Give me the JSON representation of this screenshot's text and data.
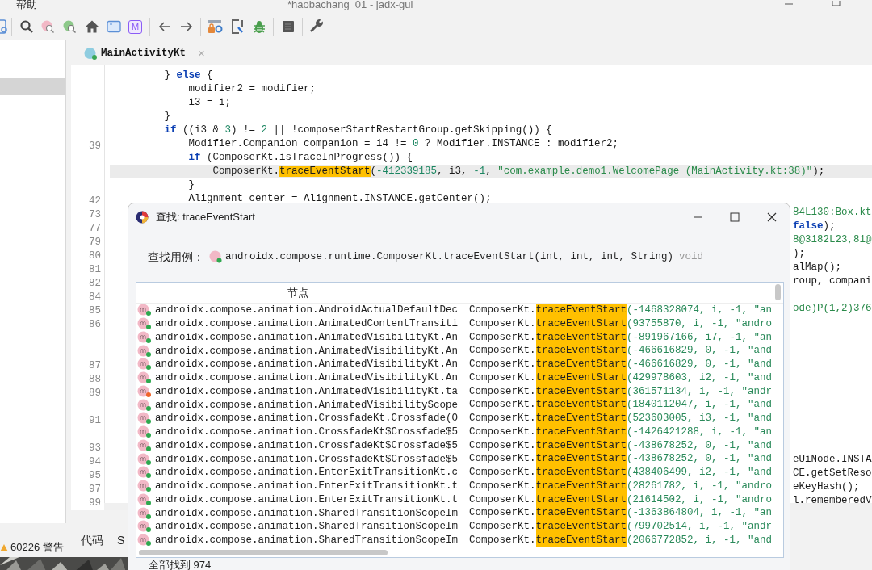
{
  "menu": {
    "item": "帮助"
  },
  "window": {
    "title": "*haobachang_01 - jadx-gui"
  },
  "toolbar": [
    {
      "kind": "doc"
    },
    {
      "kind": "separator"
    },
    {
      "kind": "search"
    },
    {
      "kind": "search-pink"
    },
    {
      "kind": "search-green"
    },
    {
      "kind": "home"
    },
    {
      "kind": "window"
    },
    {
      "kind": "letter",
      "label": "M"
    },
    {
      "kind": "separator"
    },
    {
      "kind": "back"
    },
    {
      "kind": "forward"
    },
    {
      "kind": "separator"
    },
    {
      "kind": "lock-gear"
    },
    {
      "kind": "export"
    },
    {
      "kind": "bug"
    },
    {
      "kind": "separator"
    },
    {
      "kind": "panel"
    },
    {
      "kind": "separator"
    },
    {
      "kind": "wrench"
    }
  ],
  "tree": {
    "rows": [
      {
        "selected": true
      }
    ]
  },
  "status": {
    "warnings": "60226 警告"
  },
  "editor_tabs": [
    {
      "label": "MainActivityKt",
      "close": "×",
      "selected": true
    }
  ],
  "code_lines": [
    {
      "current": false,
      "segments": [
        {
          "kind": "plain",
          "text": "         } "
        },
        {
          "kind": "kw",
          "text": "else"
        },
        {
          "kind": "plain",
          "text": " {"
        }
      ]
    },
    {
      "current": false,
      "segments": [
        {
          "kind": "plain",
          "text": "             modifier2 = modifier;"
        }
      ]
    },
    {
      "current": false,
      "segments": [
        {
          "kind": "plain",
          "text": "             i3 = i;"
        }
      ]
    },
    {
      "current": false,
      "segments": [
        {
          "kind": "plain",
          "text": "         }"
        }
      ]
    },
    {
      "current": false,
      "segments": [
        {
          "kind": "kw",
          "text": "         if"
        },
        {
          "kind": "plain",
          "text": " ((i3 & "
        },
        {
          "kind": "num",
          "text": "3"
        },
        {
          "kind": "plain",
          "text": ") != "
        },
        {
          "kind": "num",
          "text": "2"
        },
        {
          "kind": "plain",
          "text": " || !composerStartRestartGroup.getSkipping()) {"
        }
      ]
    },
    {
      "num": "39",
      "current": false,
      "segments": [
        {
          "kind": "plain",
          "text": "             Modifier.Companion companion = i4 != "
        },
        {
          "kind": "num",
          "text": "0"
        },
        {
          "kind": "plain",
          "text": " ? Modifier.INSTANCE : modifier2;"
        }
      ]
    },
    {
      "current": false,
      "segments": [
        {
          "kind": "kw",
          "text": "             if"
        },
        {
          "kind": "plain",
          "text": " (ComposerKt.isTraceInProgress()) {"
        }
      ]
    },
    {
      "current": true,
      "segments": [
        {
          "kind": "plain",
          "text": "                 ComposerKt."
        },
        {
          "kind": "match",
          "text": "traceEventStart"
        },
        {
          "kind": "plain",
          "text": "("
        },
        {
          "kind": "num",
          "text": "-412339185"
        },
        {
          "kind": "plain",
          "text": ", i3, "
        },
        {
          "kind": "num",
          "text": "-1"
        },
        {
          "kind": "plain",
          "text": ", "
        },
        {
          "kind": "str",
          "text": "\"com.example.demo1.WelcomePage (MainActivity.kt:38)\""
        },
        {
          "kind": "plain",
          "text": ");"
        }
      ]
    },
    {
      "current": false,
      "segments": [
        {
          "kind": "plain",
          "text": "             }"
        }
      ]
    },
    {
      "num": "42",
      "current": false,
      "segments": [
        {
          "kind": "plain",
          "text": "             Alignment center = Alignment.INSTANCE.getCenter();"
        }
      ]
    }
  ],
  "covered_lines": [
    {
      "kind": "clipped",
      "num": "73",
      "segments": [
        {
          "kind": "str",
          "text": "84L130:Box.kt"
        }
      ]
    },
    {
      "kind": "clipped",
      "num": "77",
      "segments": [
        {
          "kind": "kw",
          "text": "false"
        },
        {
          "kind": "plain",
          "text": ");"
        }
      ]
    },
    {
      "kind": "clipped",
      "num": "79",
      "segments": [
        {
          "kind": "str",
          "text": "8@3182L23,81@"
        }
      ]
    },
    {
      "kind": "clipped",
      "num": "80",
      "segments": [
        {
          "kind": "plain",
          "text": ");"
        }
      ]
    },
    {
      "kind": "clipped",
      "num": "81",
      "segments": [
        {
          "kind": "plain",
          "text": "alMap();"
        }
      ]
    },
    {
      "kind": "clipped",
      "num": "82",
      "segments": [
        {
          "kind": "plain",
          "text": "roup, compani"
        }
      ]
    },
    {
      "kind": "blank",
      "num": "84"
    },
    {
      "kind": "clipped",
      "num": "85",
      "segments": [
        {
          "kind": "str",
          "text": "ode)P(1,2)376"
        }
      ]
    },
    {
      "kind": "blank",
      "num": "86"
    },
    {
      "kind": "blank"
    },
    {
      "kind": "blank"
    },
    {
      "kind": "blank",
      "num": "87"
    },
    {
      "kind": "blank",
      "num": "88"
    },
    {
      "kind": "blank",
      "num": "89"
    },
    {
      "kind": "blank"
    },
    {
      "kind": "blank",
      "num": "91"
    },
    {
      "kind": "blank"
    },
    {
      "kind": "blank",
      "num": "93"
    },
    {
      "kind": "clipped",
      "num": "94",
      "segments": [
        {
          "kind": "plain",
          "text": "eUiNode.INSTA"
        }
      ]
    },
    {
      "kind": "clipped",
      "num": "95",
      "segments": [
        {
          "kind": "plain",
          "text": "CE.getSetReso"
        }
      ]
    },
    {
      "kind": "clipped",
      "num": "97",
      "segments": [
        {
          "kind": "plain",
          "text": "eKeyHash();"
        }
      ]
    },
    {
      "kind": "clipped",
      "num": "99",
      "segments": [
        {
          "kind": "plain",
          "text": "l.rememberedV"
        }
      ]
    }
  ],
  "bottom_tabs": [
    "代码",
    "S"
  ],
  "dialog": {
    "title": "查找: traceEventStart",
    "query_label": "查找用例：",
    "query_method": "androidx.compose.runtime.ComposerKt.traceEventStart(int, int, int, String)",
    "query_return": "void",
    "columns": [
      "节点"
    ],
    "results": [
      {
        "node": "androidx.compose.animation.AndroidActualDefaultDec",
        "color": "#2fa84f",
        "before": "ComposerKt.",
        "match": "traceEventStart",
        "after": "(-1468328074, i, -1, \"an"
      },
      {
        "node": "androidx.compose.animation.AnimatedContentTransiti",
        "color": "#2fa84f",
        "before": "ComposerKt.",
        "match": "traceEventStart",
        "after": "(93755870, i, -1, \"andro"
      },
      {
        "node": "androidx.compose.animation.AnimatedVisibilityKt.An",
        "color": "#2fa84f",
        "before": "ComposerKt.",
        "match": "traceEventStart",
        "after": "(-891967166, i7, -1, \"an"
      },
      {
        "node": "androidx.compose.animation.AnimatedVisibilityKt.An",
        "color": "#2fa84f",
        "before": "ComposerKt.",
        "match": "traceEventStart",
        "after": "(-466616829, 0, -1, \"and"
      },
      {
        "node": "androidx.compose.animation.AnimatedVisibilityKt.An",
        "color": "#2fa84f",
        "before": "ComposerKt.",
        "match": "traceEventStart",
        "after": "(-466616829, 0, -1, \"and"
      },
      {
        "node": "androidx.compose.animation.AnimatedVisibilityKt.An",
        "color": "#2fa84f",
        "before": "ComposerKt.",
        "match": "traceEventStart",
        "after": "(429978603, i2, -1, \"and"
      },
      {
        "node": "androidx.compose.animation.AnimatedVisibilityKt.ta",
        "color": "#f0642a",
        "before": "ComposerKt.",
        "match": "traceEventStart",
        "after": "(361571134, i, -1, \"andr"
      },
      {
        "node": "androidx.compose.animation.AnimatedVisibilityScope",
        "color": "#2fa84f",
        "before": "ComposerKt.",
        "match": "traceEventStart",
        "after": "(1840112047, i, -1, \"and"
      },
      {
        "node": "androidx.compose.animation.CrossfadeKt.Crossfade(O",
        "color": "#2fa84f",
        "before": "ComposerKt.",
        "match": "traceEventStart",
        "after": "(523603005, i3, -1, \"and"
      },
      {
        "node": "androidx.compose.animation.CrossfadeKt$Crossfade$5",
        "color": "#2fa84f",
        "before": "ComposerKt.",
        "match": "traceEventStart",
        "after": "(-1426421288, i, -1, \"an"
      },
      {
        "node": "androidx.compose.animation.CrossfadeKt$Crossfade$5",
        "color": "#2fa84f",
        "before": "ComposerKt.",
        "match": "traceEventStart",
        "after": "(-438678252, 0, -1, \"and"
      },
      {
        "node": "androidx.compose.animation.CrossfadeKt$Crossfade$5",
        "color": "#2fa84f",
        "before": "ComposerKt.",
        "match": "traceEventStart",
        "after": "(-438678252, 0, -1, \"and"
      },
      {
        "node": "androidx.compose.animation.EnterExitTransitionKt.c",
        "color": "#2fa84f",
        "before": "ComposerKt.",
        "match": "traceEventStart",
        "after": "(438406499, i2, -1, \"and"
      },
      {
        "node": "androidx.compose.animation.EnterExitTransitionKt.t",
        "color": "#2fa84f",
        "before": "ComposerKt.",
        "match": "traceEventStart",
        "after": "(28261782, i, -1, \"andro"
      },
      {
        "node": "androidx.compose.animation.EnterExitTransitionKt.t",
        "color": "#2fa84f",
        "before": "ComposerKt.",
        "match": "traceEventStart",
        "after": "(21614502, i, -1, \"andro"
      },
      {
        "node": "androidx.compose.animation.SharedTransitionScopeIm",
        "color": "#2fa84f",
        "before": "ComposerKt.",
        "match": "traceEventStart",
        "after": "(-1363864804, i, -1, \"an"
      },
      {
        "node": "androidx.compose.animation.SharedTransitionScopeIm",
        "color": "#2fa84f",
        "before": "ComposerKt.",
        "match": "traceEventStart",
        "after": "(799702514, i, -1, \"andr"
      },
      {
        "node": "androidx.compose.animation.SharedTransitionScopeIm",
        "color": "#2fa84f",
        "before": "ComposerKt.",
        "match": "traceEventStart",
        "after": "(2066772852, i, -1, \"and"
      }
    ],
    "footer": "全部找到 974"
  }
}
